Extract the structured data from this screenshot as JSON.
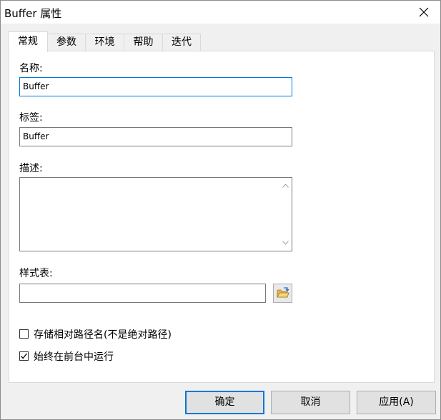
{
  "window": {
    "title": "Buffer 属性"
  },
  "tabs": [
    {
      "label": "常规",
      "active": true
    },
    {
      "label": "参数",
      "active": false
    },
    {
      "label": "环境",
      "active": false
    },
    {
      "label": "帮助",
      "active": false
    },
    {
      "label": "迭代",
      "active": false
    }
  ],
  "general": {
    "name_label": "名称:",
    "name_value": "Buffer",
    "tag_label": "标签:",
    "tag_value": "Buffer",
    "description_label": "描述:",
    "description_value": "",
    "stylesheet_label": "样式表:",
    "stylesheet_value": ""
  },
  "options": {
    "store_relative_label": "存储相对路径名(不是绝对路径)",
    "store_relative_checked": false,
    "run_foreground_label": "始终在前台中运行",
    "run_foreground_checked": true
  },
  "buttons": {
    "ok": "确定",
    "cancel": "取消",
    "apply": "应用(A)"
  },
  "icons": {
    "close": "close-icon",
    "browse": "open-folder-icon"
  },
  "colors": {
    "focus_border": "#0078d7",
    "folder_yellow": "#e8b84a"
  }
}
